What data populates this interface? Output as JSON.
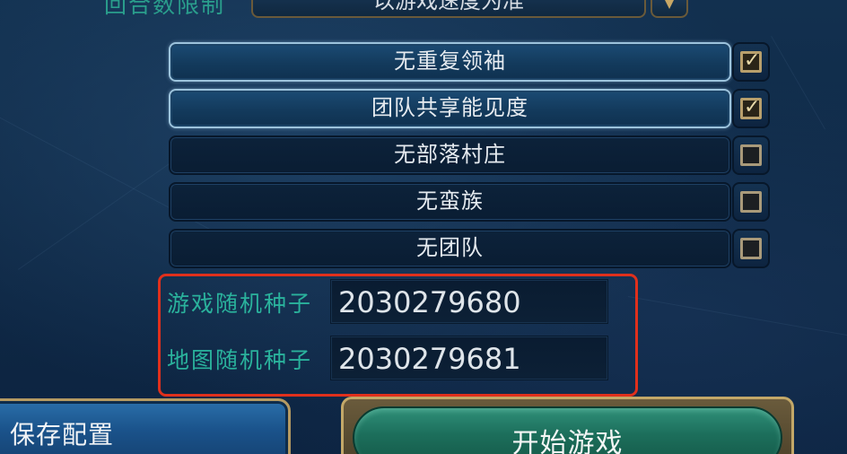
{
  "turn_limit": {
    "label": "回合数限制",
    "value": "以游戏速度为准"
  },
  "options": [
    {
      "label": "无重复领袖",
      "checked": true
    },
    {
      "label": "团队共享能见度",
      "checked": true
    },
    {
      "label": "无部落村庄",
      "checked": false
    },
    {
      "label": "无蛮族",
      "checked": false
    },
    {
      "label": "无团队",
      "checked": false
    }
  ],
  "seeds": {
    "game_seed_label": "游戏随机种子",
    "game_seed_value": "2030279680",
    "map_seed_label": "地图随机种子",
    "map_seed_value": "2030279681"
  },
  "buttons": {
    "save_config": "保存配置",
    "start_game": "开始游戏"
  },
  "highlight_color": "#e0301c"
}
